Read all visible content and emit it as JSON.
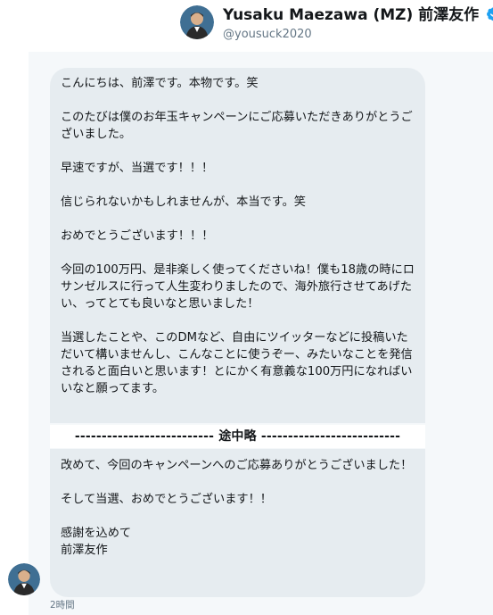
{
  "header": {
    "name": "Yusaku Maezawa (MZ) 前澤友作",
    "handle": "@yousuck2020",
    "verified_icon": "verified-badge-icon",
    "accent": "#1da1f2"
  },
  "messages": {
    "first": [
      "こんにちは、前澤です。本物です。笑",
      "このたびは僕のお年玉キャンペーンにご応募いただきありがとうございました。",
      "早速ですが、当選です！！！",
      "信じられないかもしれませんが、本当です。笑",
      "おめでとうございます！！！",
      "今回の100万円、是非楽しく使ってくださいね！僕も18歳の時にロサンゼルスに行って人生変わりましたので、海外旅行させてあげたい、ってとても良いなと思いました！",
      "当選したことや、このDMなど、自由にツイッターなどに投稿いただいて構いませんし、こんなことに使うぞー、みたいなことを発信されると面白いと思います！とにかく有意義な100万円になればいいなと願ってます。"
    ],
    "separator": "-------------------------- 途中略 --------------------------",
    "second": [
      "改めて、今回のキャンペーンへのご応募ありがとうございました！",
      "そして当選、おめでとうございます！！",
      "感謝を込めて\n前澤友作"
    ]
  },
  "timestamp": "2時間"
}
